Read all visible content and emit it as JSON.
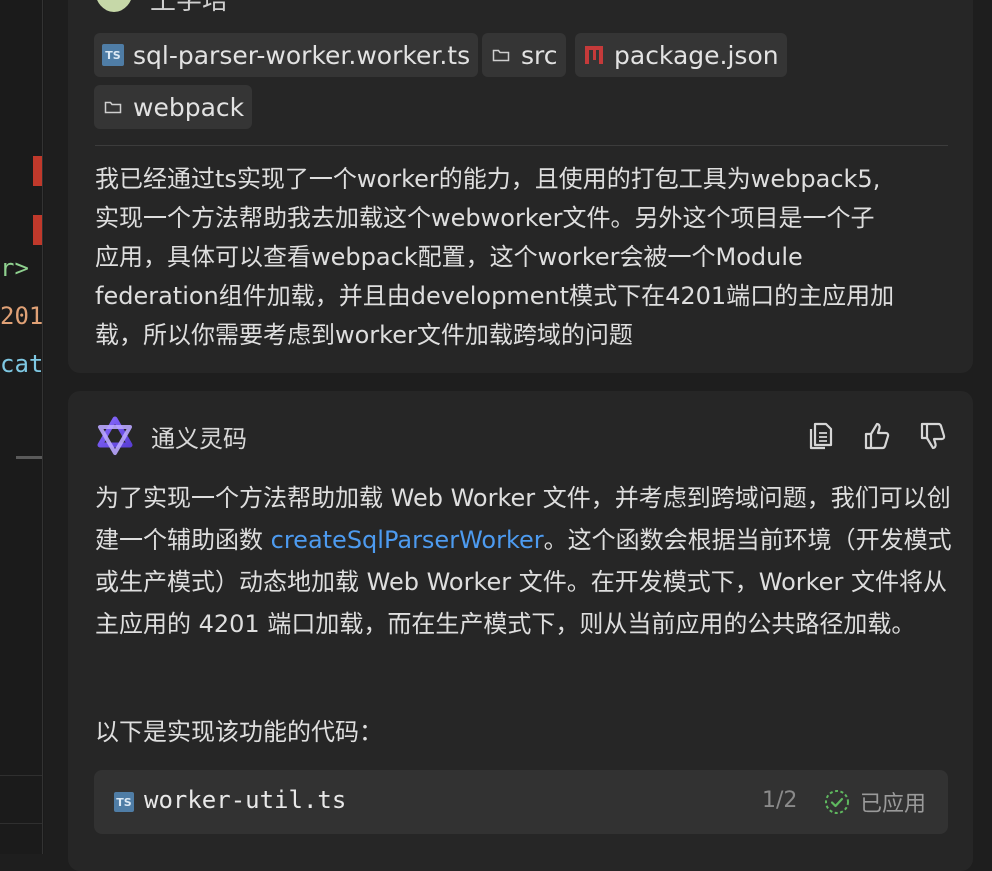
{
  "user": {
    "name": "王学培",
    "attachments": [
      {
        "label": "sql-parser-worker.worker.ts",
        "icon": "typescript-file-icon"
      },
      {
        "label": "src",
        "icon": "folder-icon"
      },
      {
        "label": "package.json",
        "icon": "npm-icon"
      },
      {
        "label": "webpack",
        "icon": "folder-icon"
      }
    ],
    "message_lines": [
      "我已经通过ts实现了一个worker的能力，且使用的打包工具为webpack5,",
      "实现一个方法帮助我去加载这个webworker文件。另外这个项目是一个子",
      "应用，具体可以查看webpack配置，这个worker会被一个Module",
      "federation组件加载，并且由development模式下在4201端口的主应用加",
      "载，所以你需要考虑到worker文件加载跨域的问题"
    ]
  },
  "assistant": {
    "name": "通义灵码",
    "actions": [
      "copy-icon",
      "thumbs-up-icon",
      "thumbs-down-icon"
    ],
    "paragraph": {
      "part1": "为了实现一个方法帮助加载 Web Worker 文件，并考虑到跨域问题，我们可以创建一个辅助函数 ",
      "link": "createSqlParserWorker",
      "part2": "。这个函数会根据当前环境（开发模式或生产模式）动态地加载 Web Worker 文件。在开发模式下，Worker 文件将从主应用的 4201 端口加载，而在生产模式下，则从当前应用的公共路径加载。"
    },
    "intro": "以下是实现该功能的代码：",
    "code_block": {
      "filename": "worker-util.ts",
      "file_icon": "TS",
      "pager": "1/2",
      "status": "已应用"
    }
  },
  "editor_fragments": [
    "r>",
    "201",
    "cat"
  ],
  "colors": {
    "background": "#1e1e1e",
    "panel": "#262626",
    "chip": "#353535",
    "link": "#4d9bf0",
    "applied_check": "#5fb85f",
    "marker": "#c0392b"
  }
}
